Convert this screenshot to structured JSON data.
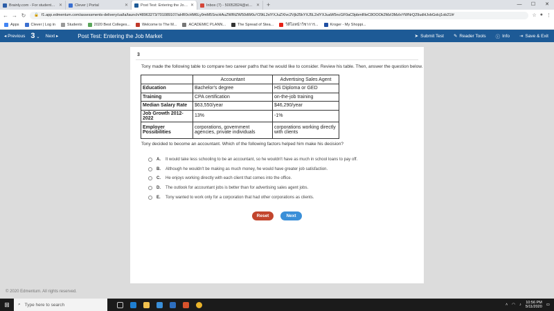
{
  "browser": {
    "tabs": [
      {
        "title": "Brainly.com - For students. By st",
        "color": "#2c5ea8",
        "active": false
      },
      {
        "title": "Clever | Portal",
        "color": "#3a6fd0",
        "active": false
      },
      {
        "title": "Post Test: Entering the Job Mark",
        "color": "#1d5a96",
        "active": true
      },
      {
        "title": "Inbox (7) - 50052824@students",
        "color": "#d44638",
        "active": false
      }
    ],
    "new_tab": "+",
    "url": "f1.app.edmentum.com/assessments-delivery/ua/la/launch/48963273/701089107/aHR0cHM6Ly9mM5SncHAuZWRtZW50dW0uY29tL2xlYXJuZXIvc2Vjb25kYXJ5L2xlYXJuaW5ncGF0aC9pbmRleC8OOOk2MzI3MzIxYWNrQ29udHJvbGxlcj1ob21l#",
    "bookmarks": [
      {
        "label": "Apps",
        "color": "#4285f4"
      },
      {
        "label": "Clever | Log in",
        "color": "#3a6fd0"
      },
      {
        "label": "Students",
        "color": "#999999"
      },
      {
        "label": "2020 Best Colleges...",
        "color": "#5aa55a"
      },
      {
        "label": "Welcome to The M...",
        "color": "#c0392b"
      },
      {
        "label": "ACADEMIC PLANN...",
        "color": "#777777"
      },
      {
        "label": "The Spread of Stea...",
        "color": "#333333"
      },
      {
        "label": "วิดีโอหน้าวิชาการ...",
        "color": "#e62117"
      },
      {
        "label": "Kroger - My Shoppi...",
        "color": "#1f4fa3"
      }
    ]
  },
  "appbar": {
    "previous": "Previous",
    "question_number": "3",
    "next": "Next",
    "title": "Post Test: Entering the Job Market",
    "submit": "Submit Test",
    "reader": "Reader Tools",
    "info": "Info",
    "save": "Save & Exit",
    "color": "#1d5a96"
  },
  "question": {
    "number": "3",
    "prompt": "Tony made the following table to compare two career paths that he would like to consider. Review his table. Then, answer the question below.",
    "table": {
      "headers": [
        "",
        "Accountant",
        "Advertising Sales Agent"
      ],
      "rows": [
        {
          "label": "Education",
          "a": "Bachelor's degree",
          "b": "HS Diploma or GED"
        },
        {
          "label": "Training",
          "a": "CPA certification",
          "b": "on-the-job training"
        },
        {
          "label": "Median Salary Rate",
          "a": "$63,550/year",
          "b": "$46,290/year"
        },
        {
          "label": "Job Growth 2012-2022",
          "a": "13%",
          "b": "-1%"
        },
        {
          "label": "Employer Possibilities",
          "a": "corporations, government agencies, private individuals",
          "b": "corporations working directly with clients"
        }
      ]
    },
    "stem": "Tony decided to become an accountant. Which of the following factors helped him make his decision?",
    "choices": [
      {
        "letter": "A.",
        "text": "It would take less schooling to be an accountant, so he wouldn't have as much in school loans to pay off."
      },
      {
        "letter": "B.",
        "text": "Although he wouldn't be making as much money, he would have greater job satisfaction."
      },
      {
        "letter": "C.",
        "text": "He enjoys working directly with each client that comes into the office."
      },
      {
        "letter": "D.",
        "text": "The outlook for accountant jobs is better than for advertising sales agent jobs."
      },
      {
        "letter": "E.",
        "text": "Tony wanted to work only for a corporation that had other corporations as clients."
      }
    ],
    "reset_label": "Reset",
    "next_label": "Next"
  },
  "footer": "© 2020 Edmentum. All rights reserved.",
  "taskbar": {
    "search_placeholder": "Type here to search",
    "time": "10:56 PM",
    "date": "5/11/2020"
  }
}
